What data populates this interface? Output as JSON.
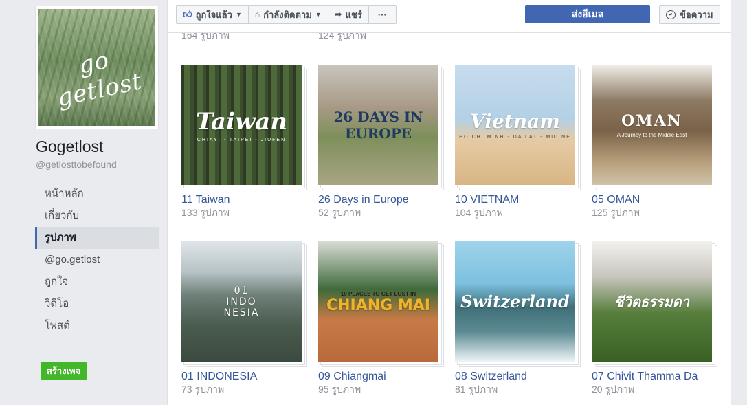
{
  "sidebar": {
    "cover_logo": "go getlost",
    "page_name": "Gogetlost",
    "page_handle": "@getlosttobefound",
    "nav": [
      {
        "label": "หน้าหลัก",
        "active": false
      },
      {
        "label": "เกี่ยวกับ",
        "active": false
      },
      {
        "label": "รูปภาพ",
        "active": true
      },
      {
        "label": "@go.getlost",
        "active": false
      },
      {
        "label": "ถูกใจ",
        "active": false
      },
      {
        "label": "วิดีโอ",
        "active": false
      },
      {
        "label": "โพสต์",
        "active": false
      }
    ],
    "create_page_label": "สร้างเพจ"
  },
  "topbar": {
    "like_label": "ถูกใจแล้ว",
    "follow_label": "กำลังติดตาม",
    "share_label": "แชร์",
    "more_label": "···",
    "send_email_label": "ส่งอีเมล",
    "message_label": "ข้อความ"
  },
  "partial_row": [
    {
      "count": "164 รูปภาพ"
    },
    {
      "count": "124 รูปภาพ"
    }
  ],
  "albums": [
    {
      "name": "11 Taiwan",
      "count": "133 รูปภาพ",
      "cover_title": "Taiwan",
      "cover_sub": "CHIAYI - TAIPEI - JIUFEN"
    },
    {
      "name": "26 Days in Europe",
      "count": "52 รูปภาพ",
      "cover_title": "26 DAYS IN EUROPE",
      "cover_sub": ""
    },
    {
      "name": "10 VIETNAM",
      "count": "104 รูปภาพ",
      "cover_title": "Vietnam",
      "cover_sub": "HO CHI MINH - DA LAT - MUI NE"
    },
    {
      "name": "05 OMAN",
      "count": "125 รูปภาพ",
      "cover_title": "OMAN",
      "cover_sub": "A Journey to the Middle East"
    },
    {
      "name": "01 INDONESIA",
      "count": "73 รูปภาพ",
      "cover_title": "01 INDO NESIA",
      "cover_sub": ""
    },
    {
      "name": "09 Chiangmai",
      "count": "95 รูปภาพ",
      "cover_title": "CHIANG MAI",
      "cover_sub": "10 PLACES TO GET LOST IN"
    },
    {
      "name": "08 Switzerland",
      "count": "81 รูปภาพ",
      "cover_title": "Switzerland",
      "cover_sub": ""
    },
    {
      "name": "07 Chivit Thamma Da",
      "count": "20 รูปภาพ",
      "cover_title": "ชีวิตธรรมดา",
      "cover_sub": ""
    }
  ],
  "colors": {
    "facebook_blue": "#4267b2",
    "link_blue": "#365899",
    "create_green": "#42b72a"
  }
}
